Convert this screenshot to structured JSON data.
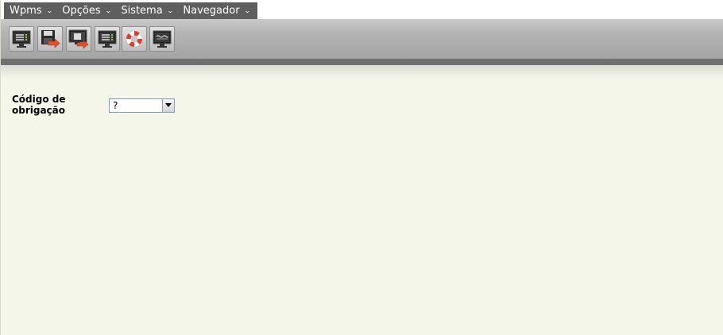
{
  "menu": {
    "items": [
      {
        "label": "Wpms",
        "icon": "chevron-down-icon"
      },
      {
        "label": "Opções",
        "icon": "chevron-down-icon"
      },
      {
        "label": "Sistema",
        "icon": "chevron-down-icon"
      },
      {
        "label": "Navegador",
        "icon": "chevron-down-icon"
      }
    ]
  },
  "toolbar": {
    "buttons": [
      {
        "icon": "monitor-list-icon"
      },
      {
        "icon": "save-export-icon"
      },
      {
        "icon": "monitor-export-icon"
      },
      {
        "icon": "monitor-list-icon"
      },
      {
        "icon": "lifebuoy-help-icon"
      },
      {
        "icon": "monitor-wave-icon"
      }
    ]
  },
  "form": {
    "codigo_obrigacao": {
      "label": "Código de obrigação",
      "value": "?"
    }
  },
  "colors": {
    "background": "#f4f6ea",
    "menu_bg": "#5e5e5e",
    "accent_orange": "#e0551a"
  }
}
